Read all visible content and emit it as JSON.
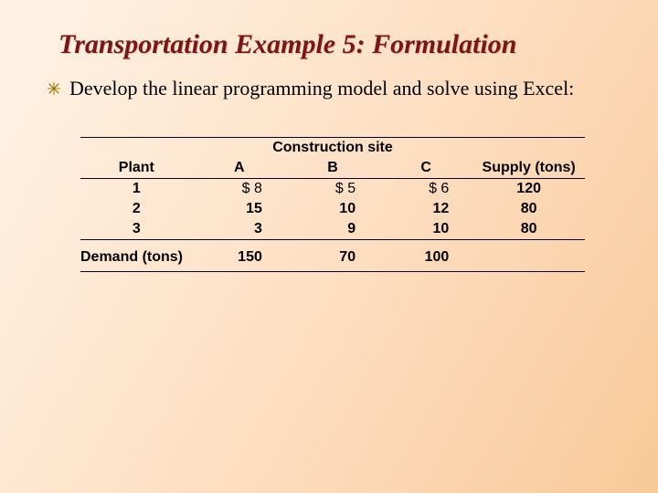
{
  "title": "Transportation Example 5: Formulation",
  "body": "Develop the linear programming model and solve using Excel:",
  "headers": {
    "plant": "Plant",
    "group": "Construction site",
    "siteA": "A",
    "siteB": "B",
    "siteC": "C",
    "supply": "Supply (tons)",
    "demand": "Demand (tons)"
  },
  "rows": [
    {
      "plant": "1",
      "A": "$  8",
      "B": "$  5",
      "C": "$  6",
      "supply": "120"
    },
    {
      "plant": "2",
      "A": "15",
      "B": "10",
      "C": "12",
      "supply": "80"
    },
    {
      "plant": "3",
      "A": "3",
      "B": "9",
      "C": "10",
      "supply": "80"
    }
  ],
  "demand": {
    "A": "150",
    "B": "70",
    "C": "100"
  },
  "chart_data": {
    "type": "table",
    "title": "Transportation cost / supply / demand",
    "columns": [
      "Plant",
      "Site A cost ($)",
      "Site B cost ($)",
      "Site C cost ($)",
      "Supply (tons)"
    ],
    "rows": [
      [
        "1",
        8,
        5,
        6,
        120
      ],
      [
        "2",
        15,
        10,
        12,
        80
      ],
      [
        "3",
        3,
        9,
        10,
        80
      ]
    ],
    "demand_tons": {
      "A": 150,
      "B": 70,
      "C": 100
    }
  }
}
